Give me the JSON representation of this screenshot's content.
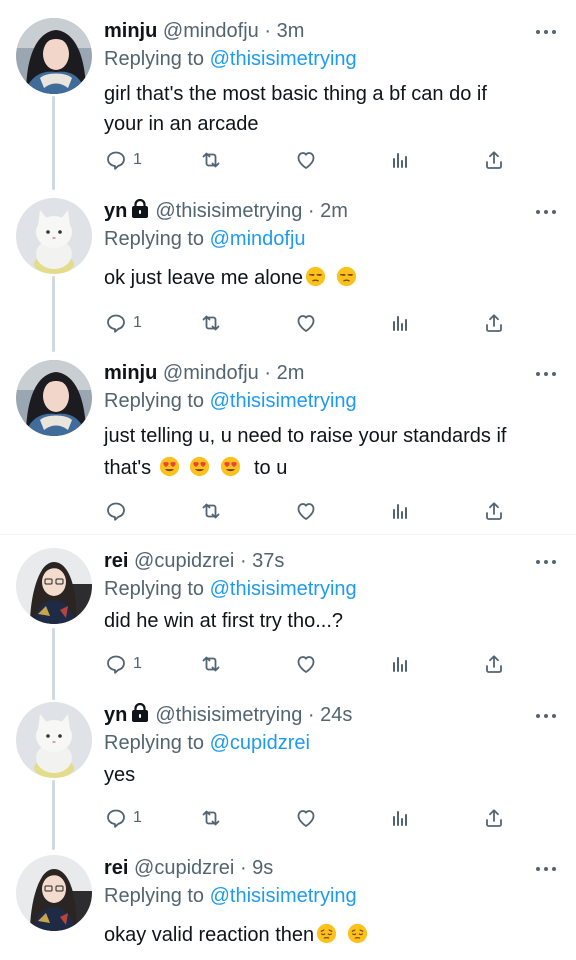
{
  "colors": {
    "link": "#1d9bf0",
    "muted": "#536471",
    "text": "#0f1419",
    "thread_line": "#cfd9de"
  },
  "tweets": [
    {
      "name": "minju",
      "handle": "@mindofju",
      "dot": "·",
      "time": "3m",
      "replying_label": "Replying to",
      "replying_handle": "@thisisimetrying",
      "text_lines": [
        "girl that's the most basic thing a bf can do if",
        "your in an arcade"
      ],
      "reply_count": "1"
    },
    {
      "name": "yn",
      "locked": true,
      "handle": "@thisisimetrying",
      "dot": "·",
      "time": "2m",
      "replying_label": "Replying to",
      "replying_handle": "@mindofju",
      "text": "ok just leave me alone",
      "emojis": [
        "unamused-face",
        "unamused-face"
      ],
      "reply_count": "1"
    },
    {
      "name": "minju",
      "handle": "@mindofju",
      "dot": "·",
      "time": "2m",
      "replying_label": "Replying to",
      "replying_handle": "@thisisimetrying",
      "text_line1": "just telling u, u need to raise your standards if",
      "text_line2_pre": "that's",
      "text_line2_post": "to u",
      "emojis": [
        "heart-eyes-face",
        "heart-eyes-face",
        "heart-eyes-face"
      ],
      "reply_count": ""
    },
    {
      "name": "rei",
      "handle": "@cupidzrei",
      "dot": "·",
      "time": "37s",
      "replying_label": "Replying to",
      "replying_handle": "@thisisimetrying",
      "text": "did he win at first try tho...?",
      "reply_count": "1"
    },
    {
      "name": "yn",
      "locked": true,
      "handle": "@thisisimetrying",
      "dot": "·",
      "time": "24s",
      "replying_label": "Replying to",
      "replying_handle": "@cupidzrei",
      "text": "yes",
      "reply_count": "1"
    },
    {
      "name": "rei",
      "handle": "@cupidzrei",
      "dot": "·",
      "time": "9s",
      "replying_label": "Replying to",
      "replying_handle": "@thisisimetrying",
      "text": "okay valid reaction then",
      "emojis": [
        "pensive-face",
        "pensive-face"
      ]
    }
  ]
}
